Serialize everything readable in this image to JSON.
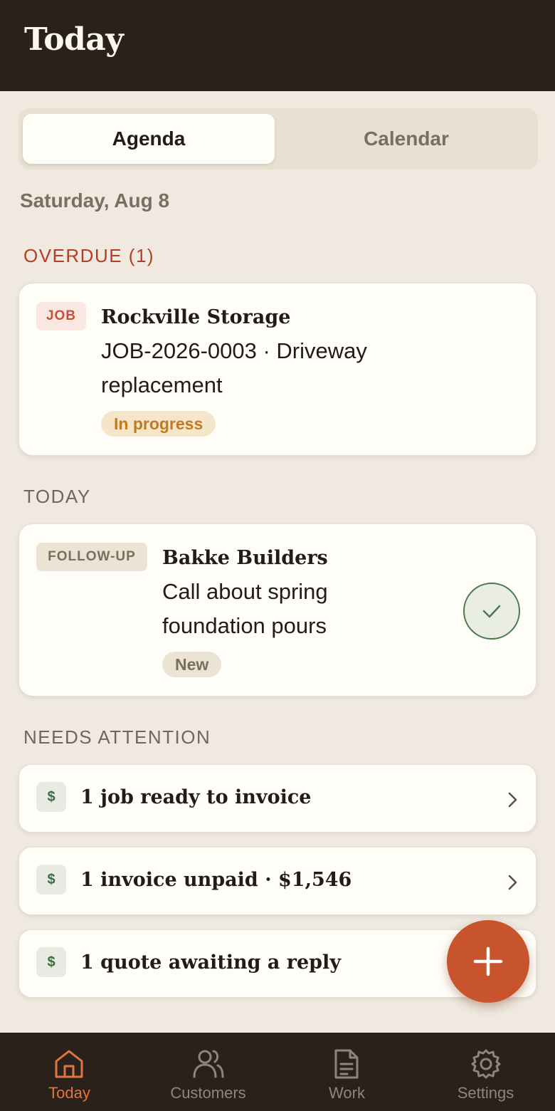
{
  "header": {
    "title": "Today"
  },
  "segment": {
    "agenda": "Agenda",
    "calendar": "Calendar",
    "selected": "Agenda"
  },
  "date": "Saturday, Aug 8",
  "sections": {
    "overdue": "OVERDUE (1)",
    "today": "TODAY",
    "needs_attention": "NEEDS ATTENTION"
  },
  "overdue_item": {
    "tag": "JOB",
    "name": "Rockville Storage",
    "desc_line1": "JOB-2026-0003 · Driveway",
    "desc_line2": "replacement",
    "status": "In progress"
  },
  "today_item": {
    "tag": "FOLLOW-UP",
    "name": "Bakke Builders",
    "desc_line1": "Call about spring",
    "desc_line2": "foundation pours",
    "status": "New"
  },
  "attention": [
    {
      "icon": "$",
      "label": "1 job ready to invoice"
    },
    {
      "icon": "$",
      "label": "1 invoice unpaid · $1,546"
    },
    {
      "icon": "$",
      "label": "1 quote awaiting a reply"
    }
  ],
  "tabs": [
    {
      "label": "Today",
      "icon": "home-icon",
      "active": true
    },
    {
      "label": "Customers",
      "icon": "users-icon",
      "active": false
    },
    {
      "label": "Work",
      "icon": "document-icon",
      "active": false
    },
    {
      "label": "Settings",
      "icon": "gear-icon",
      "active": false
    }
  ],
  "colors": {
    "accent": "#c8542d",
    "header_bg": "#2a211b",
    "overdue": "#b33d26",
    "background": "#efe9df"
  }
}
